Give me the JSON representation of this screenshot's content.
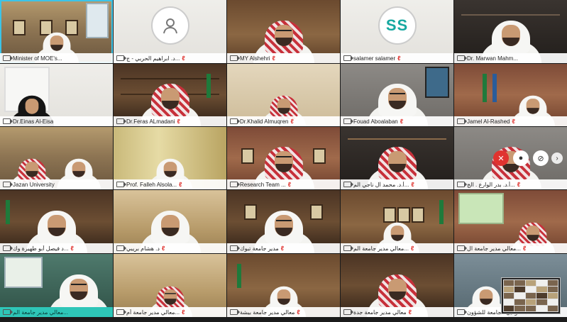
{
  "tiles": [
    {
      "name": "Minister of MOE's...",
      "kind": "video"
    },
    {
      "name": "د. ابراهيم الحربي - ج...",
      "kind": "avatar",
      "avatar_icon": "user-icon"
    },
    {
      "name": "MY Alshehri",
      "kind": "video"
    },
    {
      "name": "salamer salamer",
      "kind": "avatar",
      "initials": "SS"
    },
    {
      "name": "Dr. Marwan Mahm...",
      "kind": "video"
    },
    {
      "name": "Dr.Einas Al-Eisa",
      "kind": "video"
    },
    {
      "name": "Dr.Feras ALmadani",
      "kind": "video"
    },
    {
      "name": "Dr.Khalid Almuqren",
      "kind": "video"
    },
    {
      "name": "Fouad Aboalaban",
      "kind": "video"
    },
    {
      "name": "Jamel Al-Rashed",
      "kind": "video"
    },
    {
      "name": "Jazan University",
      "kind": "video"
    },
    {
      "name": "Prof. Falleh Alsola...",
      "kind": "video"
    },
    {
      "name": "Research Team ...",
      "kind": "video"
    },
    {
      "name": "أ.د. محمد آل ناجي الم...",
      "kind": "video"
    },
    {
      "name": "أ.د. بدر الوارع . الج...",
      "kind": "video"
    },
    {
      "name": "د فيصل أبو طهيرة وك...",
      "kind": "video"
    },
    {
      "name": "د. هشام بريبي",
      "kind": "video"
    },
    {
      "name": "مدير جامعة تبوك",
      "kind": "video"
    },
    {
      "name": "معالي مدير جامعة الم...",
      "kind": "video"
    },
    {
      "name": "معالي مدير جامعة ال...",
      "kind": "video"
    },
    {
      "name": "معالي مدير جامعة الم...",
      "kind": "video"
    },
    {
      "name": "معالي مدير جامعة أم...",
      "kind": "video"
    },
    {
      "name": "معالي مدير جامعة بيشة",
      "kind": "video"
    },
    {
      "name": "معالي مدير جامعة جدة",
      "kind": "video"
    },
    {
      "name": "وكيل الجامعة للشؤون...",
      "kind": "video"
    }
  ],
  "overlay_controls": {
    "mic_icon": "mic-off-icon",
    "chat_icon": "chat-icon",
    "block_icon": "block-icon",
    "next_icon": "chevron-right-icon"
  },
  "colors": {
    "active_border": "#3bc4e8",
    "muted_mic": "#e0332f",
    "teal_bar": "#2ec6b8"
  }
}
